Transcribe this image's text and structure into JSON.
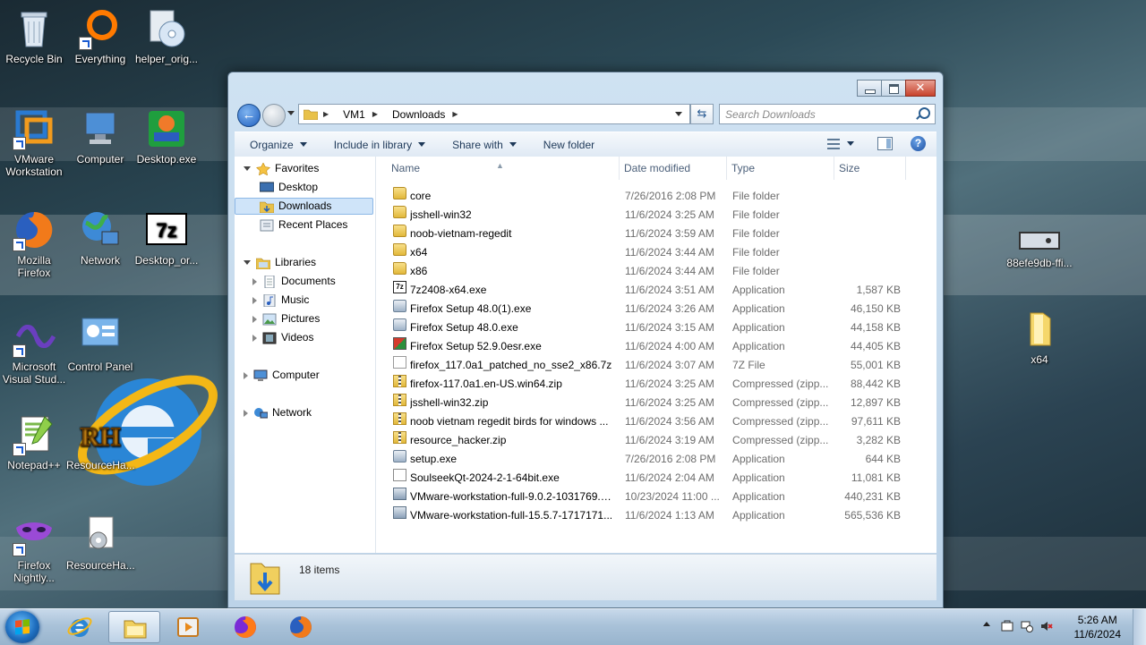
{
  "desktop": {
    "icons": [
      {
        "label": "Recycle Bin"
      },
      {
        "label": "Everything"
      },
      {
        "label": "helper_orig..."
      },
      {
        "label": "VMware Workstation"
      },
      {
        "label": "Computer"
      },
      {
        "label": "Desktop.exe"
      },
      {
        "label": "Mozilla Firefox"
      },
      {
        "label": "Network"
      },
      {
        "label": "Desktop_or..."
      },
      {
        "label": "Microsoft Visual Stud..."
      },
      {
        "label": "Control Panel"
      },
      {
        "label": "Notepad++"
      },
      {
        "label": "ResourceHa..."
      },
      {
        "label": "Firefox Nightly..."
      },
      {
        "label": "ResourceHa..."
      },
      {
        "label": "88efe9db-ffi..."
      },
      {
        "label": "x64"
      }
    ]
  },
  "explorer": {
    "breadcrumb": [
      "VM1",
      "Downloads"
    ],
    "search_placeholder": "Search Downloads",
    "commands": [
      "Organize",
      "Include in library",
      "Share with",
      "New folder"
    ],
    "nav": {
      "favorites": "Favorites",
      "desktop": "Desktop",
      "downloads": "Downloads",
      "recent": "Recent Places",
      "libraries": "Libraries",
      "documents": "Documents",
      "music": "Music",
      "pictures": "Pictures",
      "videos": "Videos",
      "computer": "Computer",
      "network": "Network"
    },
    "columns": {
      "name": "Name",
      "date": "Date modified",
      "type": "Type",
      "size": "Size"
    },
    "files": [
      {
        "name": "core",
        "date": "7/26/2016 2:08 PM",
        "type": "File folder",
        "size": "",
        "icon": "folder-icon"
      },
      {
        "name": "jsshell-win32",
        "date": "11/6/2024 3:25 AM",
        "type": "File folder",
        "size": "",
        "icon": "folder-icon"
      },
      {
        "name": "noob-vietnam-regedit",
        "date": "11/6/2024 3:59 AM",
        "type": "File folder",
        "size": "",
        "icon": "folder-icon"
      },
      {
        "name": "x64",
        "date": "11/6/2024 3:44 AM",
        "type": "File folder",
        "size": "",
        "icon": "folder-icon"
      },
      {
        "name": "x86",
        "date": "11/6/2024 3:44 AM",
        "type": "File folder",
        "size": "",
        "icon": "folder-icon"
      },
      {
        "name": "7z2408-x64.exe",
        "date": "11/6/2024 3:51 AM",
        "type": "Application",
        "size": "1,587 KB",
        "icon": "7zip-icon"
      },
      {
        "name": "Firefox Setup 48.0(1).exe",
        "date": "11/6/2024 3:26 AM",
        "type": "Application",
        "size": "46,150 KB",
        "icon": "installer-icon"
      },
      {
        "name": "Firefox Setup 48.0.exe",
        "date": "11/6/2024 3:15 AM",
        "type": "Application",
        "size": "44,158 KB",
        "icon": "installer-icon"
      },
      {
        "name": "Firefox Setup 52.9.0esr.exe",
        "date": "11/6/2024 4:00 AM",
        "type": "Application",
        "size": "44,405 KB",
        "icon": "firefox-esr-icon"
      },
      {
        "name": "firefox_117.0a1_patched_no_sse2_x86.7z",
        "date": "11/6/2024 3:07 AM",
        "type": "7Z File",
        "size": "55,001 KB",
        "icon": "document-icon"
      },
      {
        "name": "firefox-117.0a1.en-US.win64.zip",
        "date": "11/6/2024 3:25 AM",
        "type": "Compressed (zipp...",
        "size": "88,442 KB",
        "icon": "zip-icon"
      },
      {
        "name": "jsshell-win32.zip",
        "date": "11/6/2024 3:25 AM",
        "type": "Compressed (zipp...",
        "size": "12,897 KB",
        "icon": "zip-icon"
      },
      {
        "name": "noob vietnam regedit birds for windows ...",
        "date": "11/6/2024 3:56 AM",
        "type": "Compressed (zipp...",
        "size": "97,611 KB",
        "icon": "zip-icon"
      },
      {
        "name": "resource_hacker.zip",
        "date": "11/6/2024 3:19 AM",
        "type": "Compressed (zipp...",
        "size": "3,282 KB",
        "icon": "zip-icon"
      },
      {
        "name": "setup.exe",
        "date": "7/26/2016 2:08 PM",
        "type": "Application",
        "size": "644 KB",
        "icon": "installer-icon"
      },
      {
        "name": "SoulseekQt-2024-2-1-64bit.exe",
        "date": "11/6/2024 2:04 AM",
        "type": "Application",
        "size": "11,081 KB",
        "icon": "soulseek-icon"
      },
      {
        "name": "VMware-workstation-full-9.0.2-1031769.e...",
        "date": "10/23/2024 11:00 ...",
        "type": "Application",
        "size": "440,231 KB",
        "icon": "vmware-icon"
      },
      {
        "name": "VMware-workstation-full-15.5.7-1717171...",
        "date": "11/6/2024 1:13 AM",
        "type": "Application",
        "size": "565,536 KB",
        "icon": "vmware-icon"
      }
    ],
    "status": "18 items"
  },
  "taskbar": {
    "time": "5:26 AM",
    "date": "11/6/2024"
  },
  "colors": {
    "accent": "#1f5fbf",
    "selection": "#cfe4f9"
  }
}
